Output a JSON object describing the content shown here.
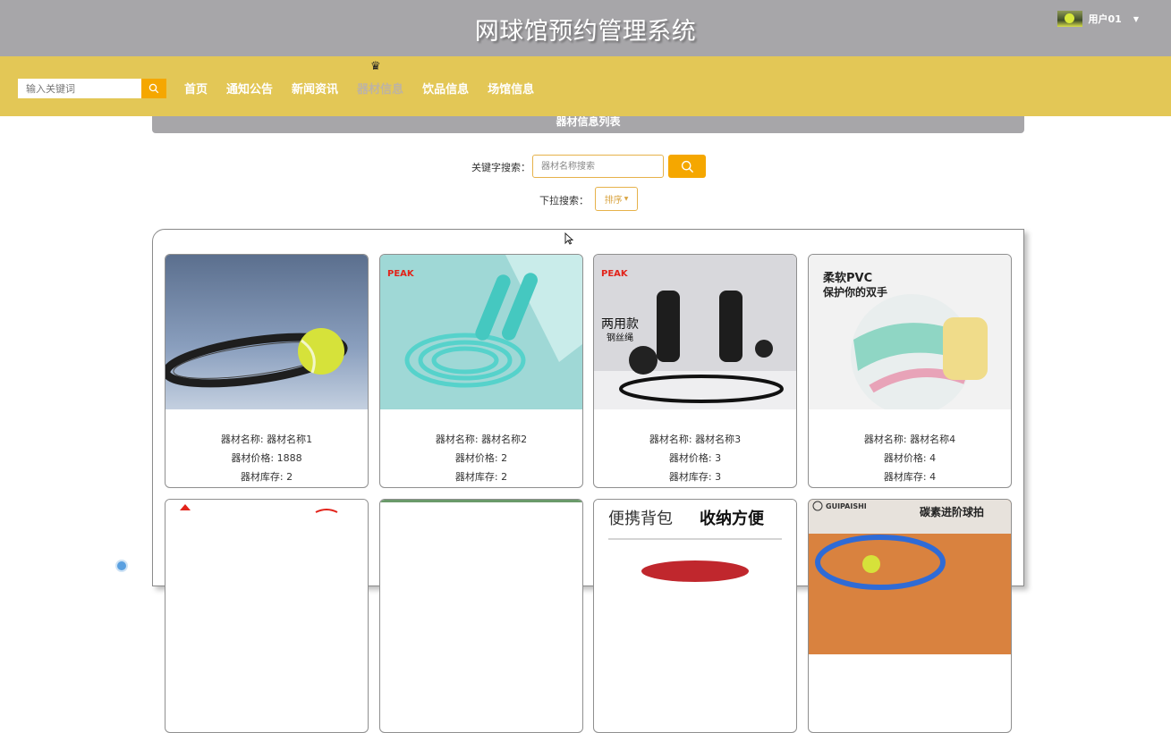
{
  "header": {
    "title": "网球馆预约管理系统",
    "user_name": "用户01"
  },
  "nav": {
    "search_placeholder": "输入关键词",
    "items": [
      {
        "label": "首页"
      },
      {
        "label": "通知公告"
      },
      {
        "label": "新闻资讯"
      },
      {
        "label": "器材信息",
        "active": true
      },
      {
        "label": "饮品信息"
      },
      {
        "label": "场馆信息"
      }
    ]
  },
  "section": {
    "title": "器材信息列表"
  },
  "filters": {
    "keyword_label": "关键字搜索：",
    "keyword_placeholder": "器材名称搜索",
    "dropdown_label": "下拉搜索：",
    "sort_label": "排序"
  },
  "cards": [
    {
      "name": "器材名称: 器材名称1",
      "price": "器材价格: 1888",
      "stock": "器材库存: 2",
      "image": "tennis-racket-ball"
    },
    {
      "name": "器材名称: 器材名称2",
      "price": "器材价格: 2",
      "stock": "器材库存: 2",
      "image": "jump-rope-cyan"
    },
    {
      "name": "器材名称: 器材名称3",
      "price": "器材价格: 3",
      "stock": "器材库存: 3",
      "image": "jump-rope-black",
      "image_text": [
        "两用款",
        "钢丝绳"
      ]
    },
    {
      "name": "器材名称: 器材名称4",
      "price": "器材价格: 4",
      "stock": "器材库存: 4",
      "image": "volleyball",
      "image_text": [
        "柔软PVC",
        "保护你的双手"
      ]
    },
    {
      "image": "peak-logo-product"
    },
    {
      "image": "blank-product"
    },
    {
      "image": "bag-product",
      "image_text": [
        "便携背包",
        "收纳方便"
      ]
    },
    {
      "image": "tennis-racket-orange",
      "image_text": [
        "GUIPAISHI",
        "碳素进阶球拍"
      ]
    }
  ],
  "colors": {
    "title_bar": "#a7a6a9",
    "nav_bar": "#e3c756",
    "accent": "#f5a700",
    "nav_active": "#bdb3a4"
  }
}
